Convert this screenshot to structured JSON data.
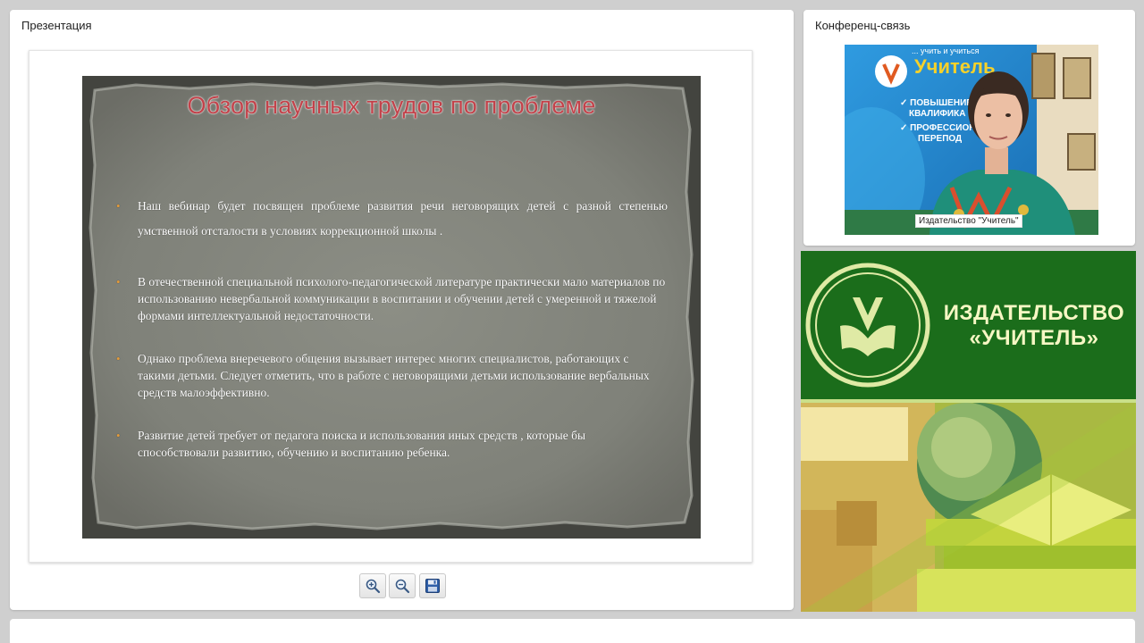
{
  "presentation": {
    "panel_title": "Презентация",
    "slide": {
      "title": "Обзор научных трудов по проблеме",
      "bullets": [
        "Наш вебинар будет посвящен проблеме развития речи неговорящих детей с разной степенью умственной отсталости в условиях коррекционной школы .",
        "В отечественной специальной психолого-педагогической литературе практически мало материалов по использованию невербальной коммуникации в воспитании и обучении детей с умеренной и тяжелой формами интеллектуальной недостаточности.",
        "Однако проблема внеречевого общения вызывает интерес многих специалистов, работающих с такими детьми. Следует отметить, что в работе с неговорящими детьми использование вербальных средств малоэффективно.",
        "Развитие детей требует от педагога поиска и использования иных средств , которые бы способствовали развитию, обучению и воспитанию ребенка."
      ]
    },
    "toolbar": {
      "zoom_in_icon": "zoom-in-icon",
      "zoom_out_icon": "zoom-out-icon",
      "save_icon": "floppy-disk-icon"
    }
  },
  "conference": {
    "panel_title": "Конференц-связь",
    "video_label": "Издательство \"Учитель\"",
    "backdrop_text": {
      "top": "... учить и учиться",
      "logo": "Учитель",
      "item1": "✓ ПОВЫШЕНИЕ",
      "item2": "КВАЛИФИКА",
      "item3": "✓ ПРОФЕССИОН",
      "item4": "ПЕРЕПОД"
    }
  },
  "ad": {
    "line1": "ИЗДАТЕЛЬСТВО",
    "line2": "«УЧИТЕЛЬ»",
    "brand_color": "#1b6d1b",
    "text_color": "#f7f7c4"
  }
}
